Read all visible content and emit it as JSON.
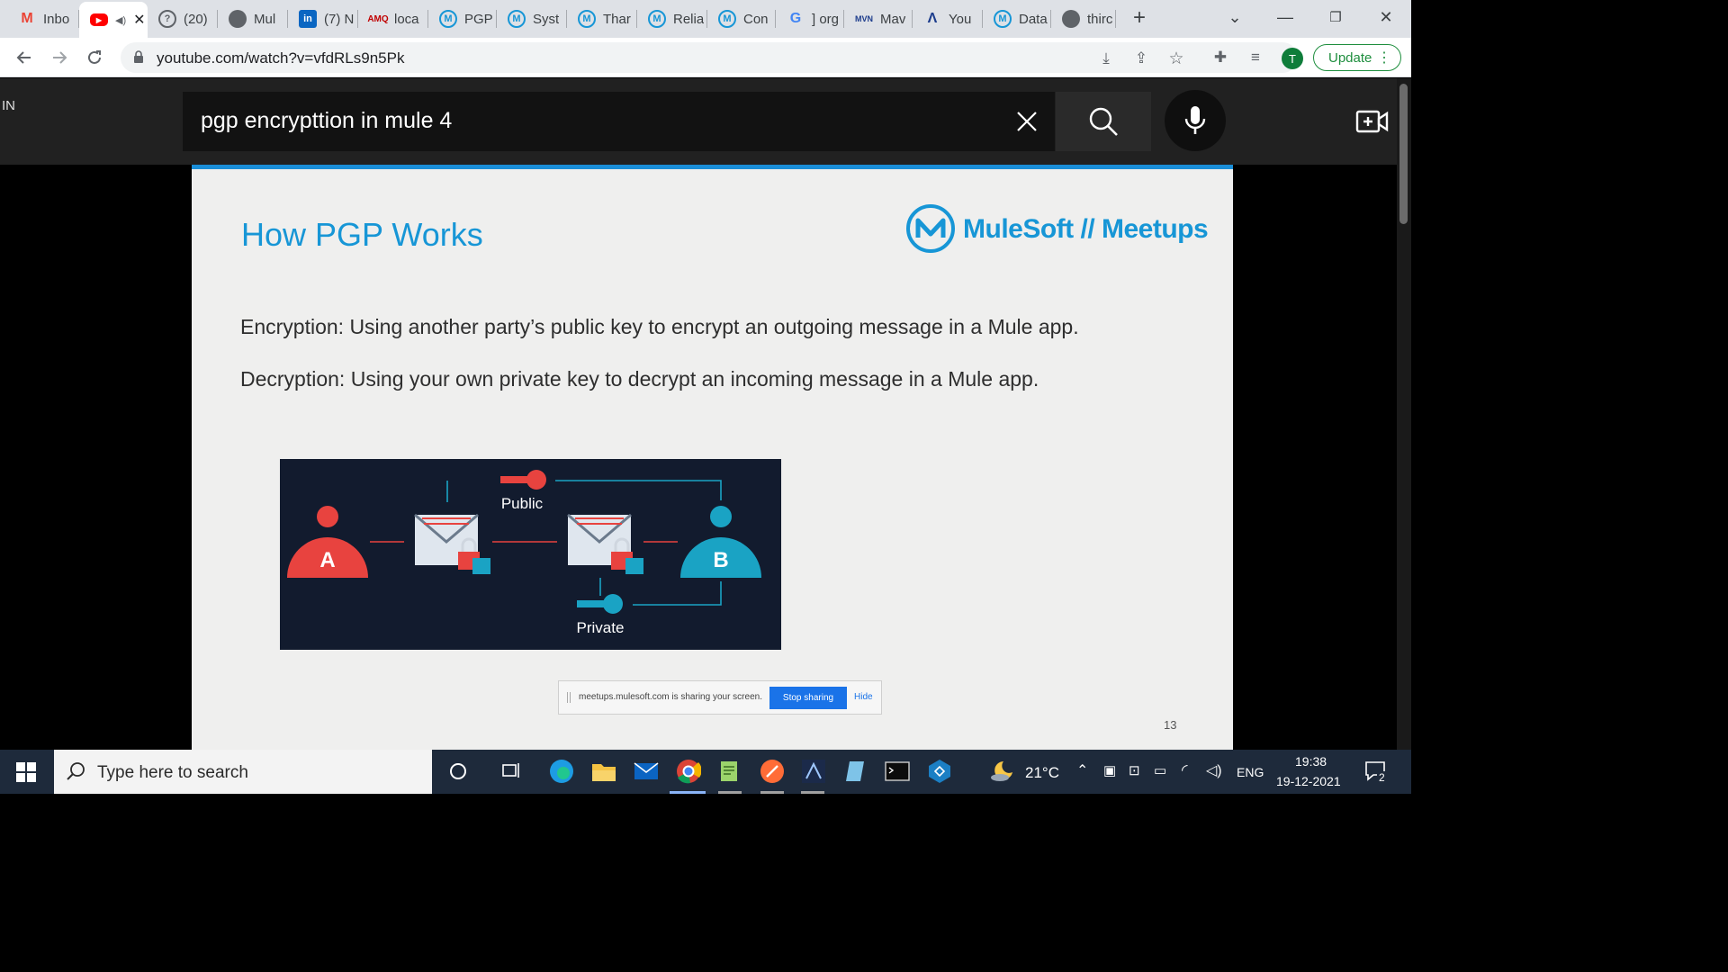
{
  "browser": {
    "tabs": [
      {
        "title": "Inbo",
        "icon": "gmail-icon",
        "color": "#ea4335"
      },
      {
        "title": "",
        "icon": "youtube-icon",
        "color": "#ff0000",
        "active": true
      },
      {
        "title": "(20)",
        "icon": "globe-icon",
        "color": "#5f6368"
      },
      {
        "title": "Mul",
        "icon": "globe-icon",
        "color": "#5f6368"
      },
      {
        "title": "(7) N",
        "icon": "linkedin-icon",
        "color": "#0a66c2"
      },
      {
        "title": "loca",
        "icon": "amq-icon",
        "color": "#c00000"
      },
      {
        "title": "PGP",
        "icon": "mulesoft-icon",
        "color": "#1796d6"
      },
      {
        "title": "Syst",
        "icon": "mulesoft-icon",
        "color": "#1796d6"
      },
      {
        "title": "Thar",
        "icon": "mulesoft-icon",
        "color": "#1796d6"
      },
      {
        "title": "Relia",
        "icon": "mulesoft-icon",
        "color": "#1796d6"
      },
      {
        "title": "Con",
        "icon": "mulesoft-icon",
        "color": "#1796d6"
      },
      {
        "title": "] org",
        "icon": "google-icon",
        "color": "#4285f4"
      },
      {
        "title": "Mav",
        "icon": "maven-icon",
        "color": "#1c3c8c"
      },
      {
        "title": "You",
        "icon": "m-logo-icon",
        "color": "#1c3c8c"
      },
      {
        "title": "Data",
        "icon": "mulesoft-icon",
        "color": "#1796d6"
      },
      {
        "title": "thirc",
        "icon": "globe-icon",
        "color": "#5f6368"
      }
    ],
    "url": "youtube.com/watch?v=vfdRLs9n5Pk",
    "profile_initial": "T",
    "update_label": "Update"
  },
  "youtube": {
    "region": "IN",
    "search_query": "pgp encrypttion in mule 4"
  },
  "slide": {
    "title": "How PGP Works",
    "brand": "MuleSoft // Meetups",
    "line1": "Encryption: Using another party’s public key to encrypt an outgoing message in a Mule app.",
    "line2": "Decryption: Using your own private key to decrypt an incoming message in a Mule app.",
    "diagram": {
      "public_label": "Public",
      "private_label": "Private",
      "party_a": "A",
      "party_b": "B"
    },
    "share_message": "meetups.mulesoft.com is sharing your screen.",
    "stop_sharing": "Stop sharing",
    "hide": "Hide",
    "page_number": "13"
  },
  "taskbar": {
    "search_placeholder": "Type here to search",
    "temperature": "21°C",
    "language": "ENG",
    "time": "19:38",
    "date": "19-12-2021",
    "notification_count": "2"
  },
  "colors": {
    "accent": "#1796d6",
    "diagram_bg": "#121b2e",
    "party_a": "#e8433f",
    "party_b": "#1aa3c4"
  }
}
